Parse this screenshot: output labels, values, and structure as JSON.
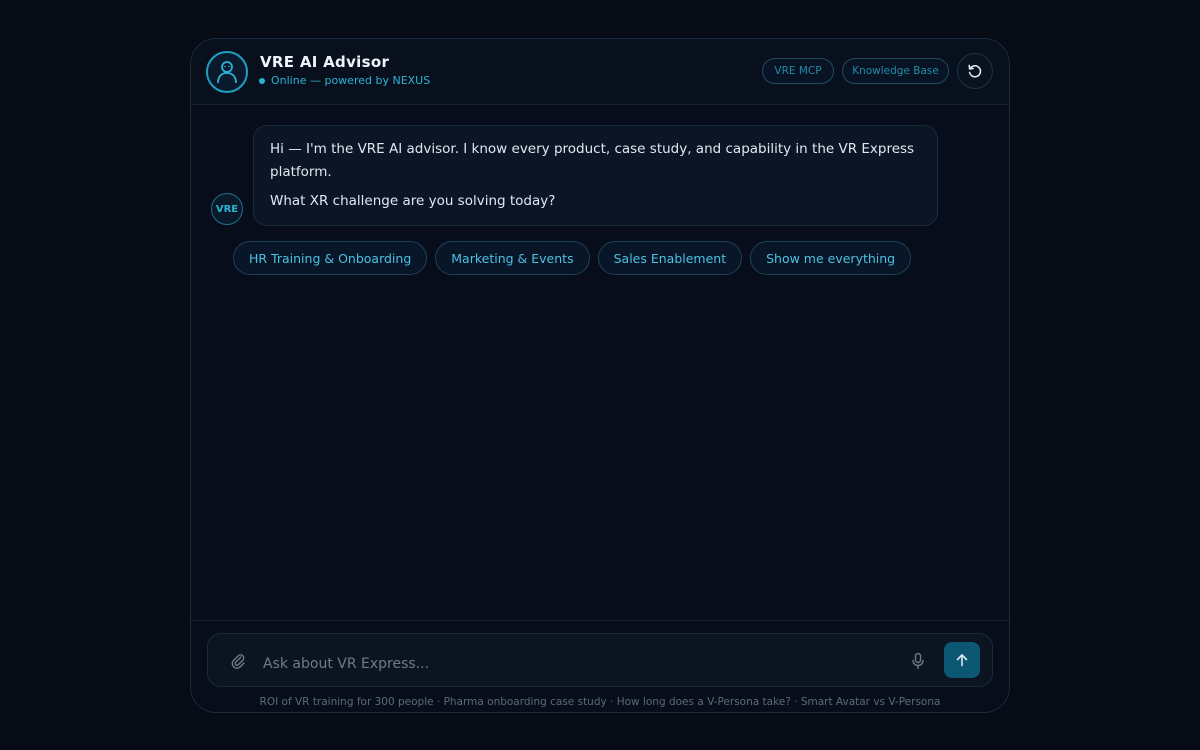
{
  "header": {
    "title": "VRE AI Advisor",
    "status": "Online — powered by NEXUS",
    "pills": [
      "VRE MCP",
      "Knowledge Base"
    ],
    "avatar_icon": "user-icon",
    "refresh_icon": "refresh-icon"
  },
  "message": {
    "avatar_label": "VRE",
    "lines": [
      "Hi — I'm the VRE AI advisor. I know every product, case study, and capability in the VR Express platform.",
      "What XR challenge are you solving today?"
    ]
  },
  "chips": [
    "HR Training & Onboarding",
    "Marketing & Events",
    "Sales Enablement",
    "Show me everything"
  ],
  "composer": {
    "placeholder": "Ask about VR Express...",
    "value": ""
  },
  "suggestions": "ROI of VR training for 300 people · Pharma onboarding case study · How long does a V-Persona take? · Smart Avatar vs V-Persona",
  "colors": {
    "accent": "#2ab3d6",
    "background": "#060b16",
    "send": "#0c5872"
  }
}
